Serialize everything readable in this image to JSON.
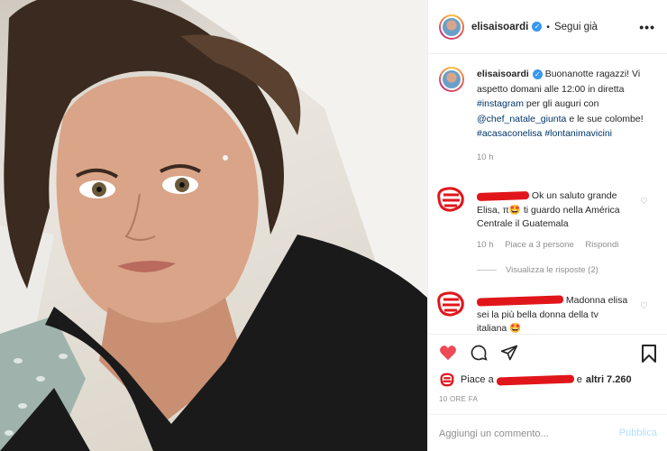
{
  "post": {
    "username": "elisaisoardi",
    "follow_label": "Segui già",
    "more_label": "•••"
  },
  "caption": {
    "username": "elisaisoardi",
    "text_1": "Buonanotte ragazzi! Vi aspetto domani alle 12:00 in diretta",
    "hashtag_instagram": "#instagram",
    "text_2": "per gli auguri con",
    "mention": "@chef_natale_giunta",
    "text_3": "e le sue colombe!",
    "hashtag_1": "#acasaconelisa",
    "hashtag_2": "#lontanimavicini",
    "time": "10 h"
  },
  "comments": [
    {
      "text": "Ok un saluto grande Elisa, π🤩 ti guardo nella América Centrale il Guatemala",
      "time": "10 h",
      "likes": "Piace a 3 persone",
      "reply": "Rispondi",
      "view_replies": "Visualizza le risposte (2)"
    },
    {
      "text": "Madonna elisa sei la più bella donna della tv italiana 🤩"
    }
  ],
  "likes": {
    "prefix": "Piace a",
    "suffix": "e",
    "others": "altri 7.260"
  },
  "date": "10 ORE FA",
  "add_comment": {
    "placeholder": "Aggiungi un commento...",
    "publish_label": "Pubblica"
  },
  "colors": {
    "accent_blue": "#3897f0",
    "like_red": "#ed4956",
    "redaction_red": "#e0161b",
    "muted": "#8e8e8e"
  }
}
